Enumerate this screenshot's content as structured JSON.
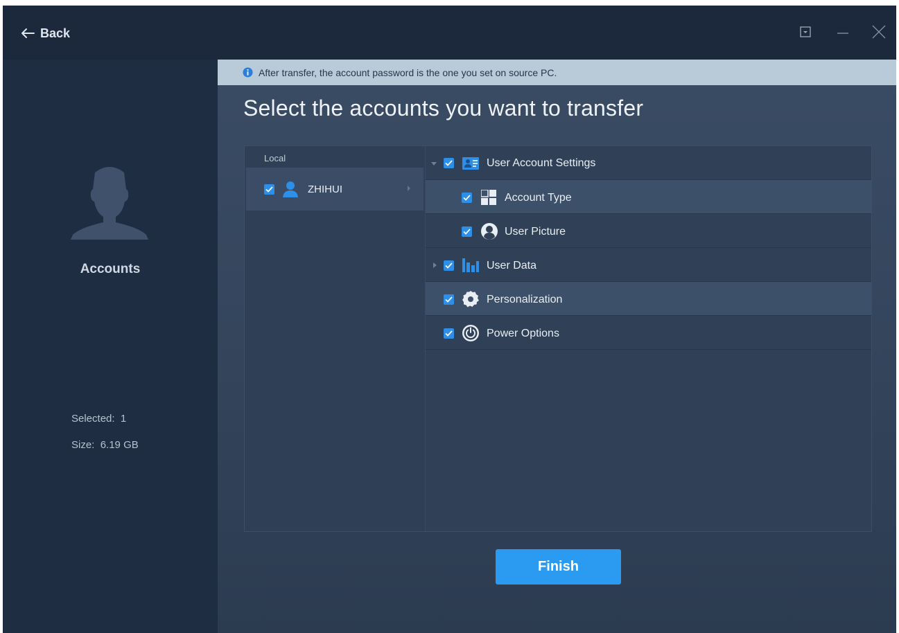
{
  "titlebar": {
    "back_label": "Back"
  },
  "sidebar": {
    "title": "Accounts",
    "selected_label": "Selected:",
    "selected_value": "1",
    "size_label": "Size:",
    "size_value": "6.19 GB"
  },
  "notice": {
    "text": "After transfer, the account password is the one you set on source PC."
  },
  "main": {
    "heading": "Select the accounts you want to transfer",
    "local_label": "Local",
    "user": {
      "name": "ZHIHUI",
      "checked": true
    },
    "tree": [
      {
        "label": "User Account Settings",
        "icon": "user-card-icon",
        "checked": true,
        "expanded": true,
        "level": 0
      },
      {
        "label": "Account Type",
        "icon": "tiles-icon",
        "checked": true,
        "level": 1
      },
      {
        "label": "User Picture",
        "icon": "user-picture-icon",
        "checked": true,
        "level": 1
      },
      {
        "label": "User Data",
        "icon": "bar-data-icon",
        "checked": true,
        "expanded": false,
        "level": 0
      },
      {
        "label": "Personalization",
        "icon": "gear-icon",
        "checked": true,
        "level": 0
      },
      {
        "label": "Power Options",
        "icon": "power-icon",
        "checked": true,
        "level": 0
      }
    ],
    "finish_label": "Finish"
  },
  "colors": {
    "accent": "#2b9bf2",
    "checkbox": "#2d8fe8",
    "sidebar_bg": "#1f2d42",
    "notice_bg": "#b9cad9"
  }
}
